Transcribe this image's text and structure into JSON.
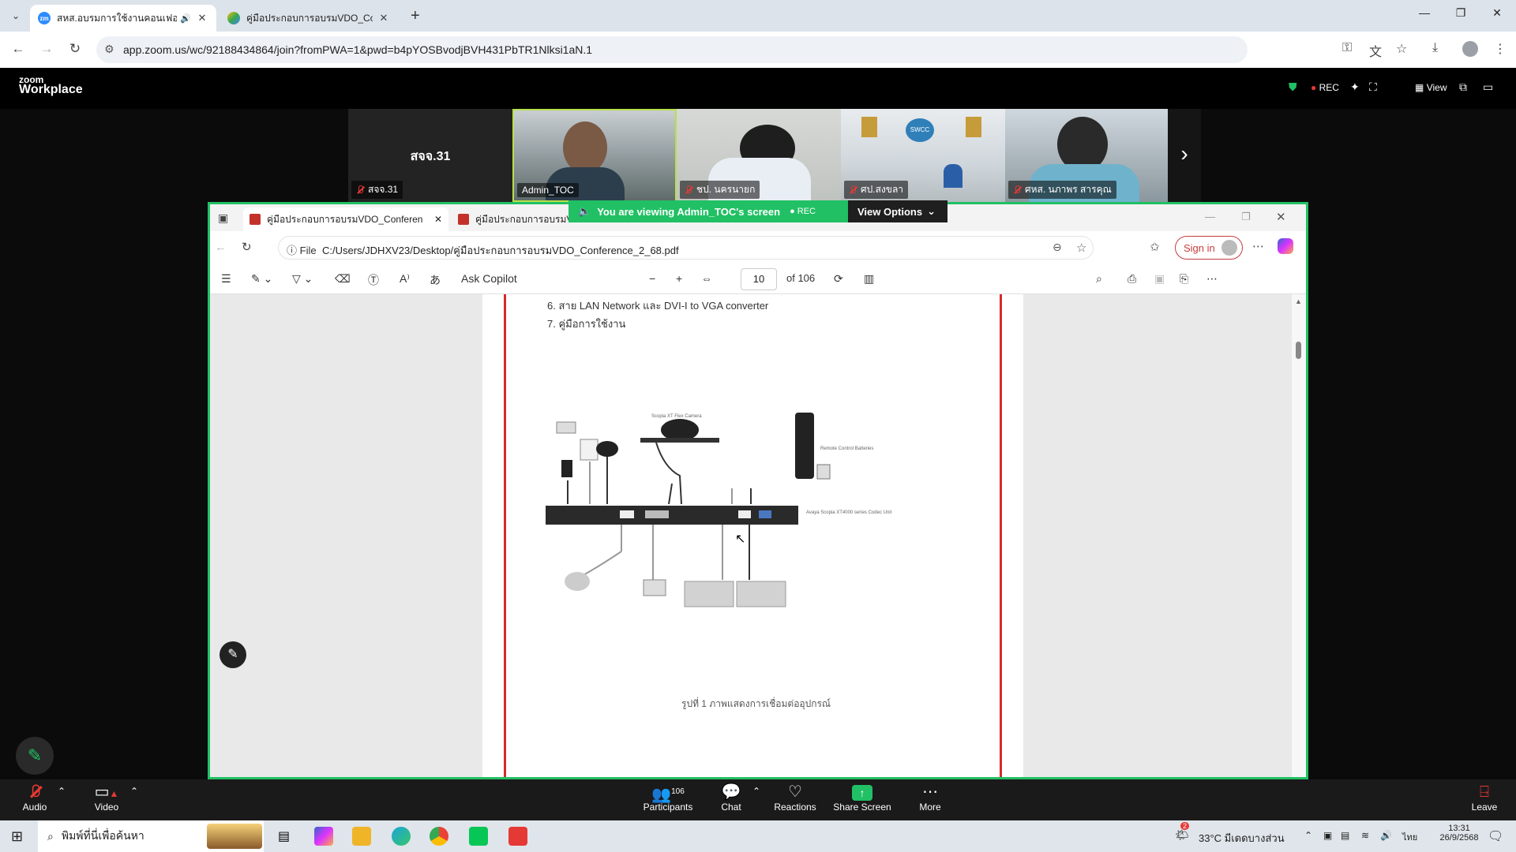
{
  "browser": {
    "tabs": [
      {
        "title": "สหส.อบรมการใช้งานคอนเฟอร์ร",
        "active": true,
        "icon": "zoom-icon"
      },
      {
        "title": "คู่มือประกอบการอบรมVDO_Confe",
        "active": false,
        "icon": "google-drive-icon"
      }
    ],
    "url": "app.zoom.us/wc/92188434864/join?fromPWA=1&pwd=b4pYOSBvodjBVH431PbTR1Nlksi1aN.1"
  },
  "zoom": {
    "brand_top": "zoom",
    "brand_bottom": "Workplace",
    "rec_label": "REC",
    "view_label": "View",
    "participants_tiles": [
      {
        "name": "สจจ.31",
        "center_text": "สจจ.31",
        "muted": true
      },
      {
        "name": "Admin_TOC",
        "muted": false
      },
      {
        "name": "ชป. นครนายก",
        "muted": true
      },
      {
        "name": "ศป.สงขลา",
        "muted": true
      },
      {
        "name": "ศหส. นภาพร สารคุณ",
        "muted": true
      }
    ],
    "viewing_banner": "You are viewing  Admin_TOC's screen",
    "viewing_rec": "REC",
    "view_options": "View Options",
    "bottom_bar": {
      "audio": "Audio",
      "video": "Video",
      "participants": "Participants",
      "participants_count": "106",
      "chat": "Chat",
      "reactions": "Reactions",
      "share_screen": "Share Screen",
      "more": "More",
      "leave": "Leave"
    }
  },
  "shared_screen": {
    "edge_tabs": [
      {
        "title": "คู่มือประกอบการอบรมVDO_Conferen"
      },
      {
        "title": "คู่มือประกอบการอบรมV"
      }
    ],
    "file_label": "File",
    "file_path": "C:/Users/JDHXV23/Desktop/คู่มือประกอบการอบรมVDO_Conference_2_68.pdf",
    "sign_in": "Sign in",
    "ask_copilot": "Ask Copilot",
    "page_number": "10",
    "page_total": "of 106",
    "pdf_lines": [
      "6. สาย  LAN  Network และ  DVI-I  to VGA converter",
      "7. คู่มือการใช้งาน"
    ],
    "figure_labels": {
      "camera": "Scopia XT Flex Camera",
      "remote": "Remote Control Batteries",
      "codec": "Avaya Scopia XT4000 series Codec Unit"
    },
    "caption": "รูปที่ 1 ภาพแสดงการเชื่อมต่ออุปกรณ์"
  },
  "taskbar": {
    "search_placeholder": "พิมพ์ที่นี่เพื่อค้นหา",
    "weather": "33°C  มีเดดบางส่วน",
    "lang": "ไทย",
    "time": "13:31",
    "date": "26/9/2568",
    "notif_count": "2"
  },
  "colors": {
    "share_border": "#21c064",
    "rec_red": "#e53935",
    "pdf_border": "#d62b2b"
  }
}
